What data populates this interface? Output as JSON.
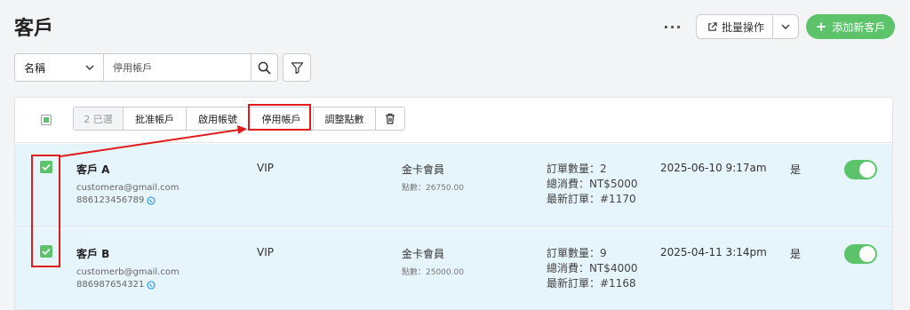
{
  "header": {
    "title": "客戶",
    "more_icon": "more-horizontal-icon",
    "bulk_label": "批量操作",
    "add_label": "添加新客戶"
  },
  "filter": {
    "field": "名稱",
    "value": "停用帳戶"
  },
  "toolbar": {
    "selected": "2 已選",
    "approve": "批准帳戶",
    "enable": "啟用帳號",
    "disable": "停用帳戶",
    "adjust_points": "調整點數"
  },
  "customers": [
    {
      "name": "客戶 A",
      "email": "customera@gmail.com",
      "phone": "886123456789",
      "tier": "VIP",
      "membership": "金卡會員",
      "points": "點數：26750.00",
      "order_count": "訂單數量：2",
      "total_spent": "總消費：NT$5000",
      "latest_order": "最新訂單：#1170",
      "date": "2025-06-10 9:17am",
      "flag": "是",
      "selected": true,
      "enabled": true
    },
    {
      "name": "客戶 B",
      "email": "customerb@gmail.com",
      "phone": "886987654321",
      "tier": "VIP",
      "membership": "金卡會員",
      "points": "點數：25000.00",
      "order_count": "訂單數量：9",
      "total_spent": "總消費：NT$4000",
      "latest_order": "最新訂單：#1168",
      "date": "2025-04-11 3:14pm",
      "flag": "是",
      "selected": true,
      "enabled": true
    }
  ],
  "colors": {
    "accent": "#5cc36a",
    "annotation": "#e01b1b",
    "row_selected": "#e6f4fb"
  }
}
